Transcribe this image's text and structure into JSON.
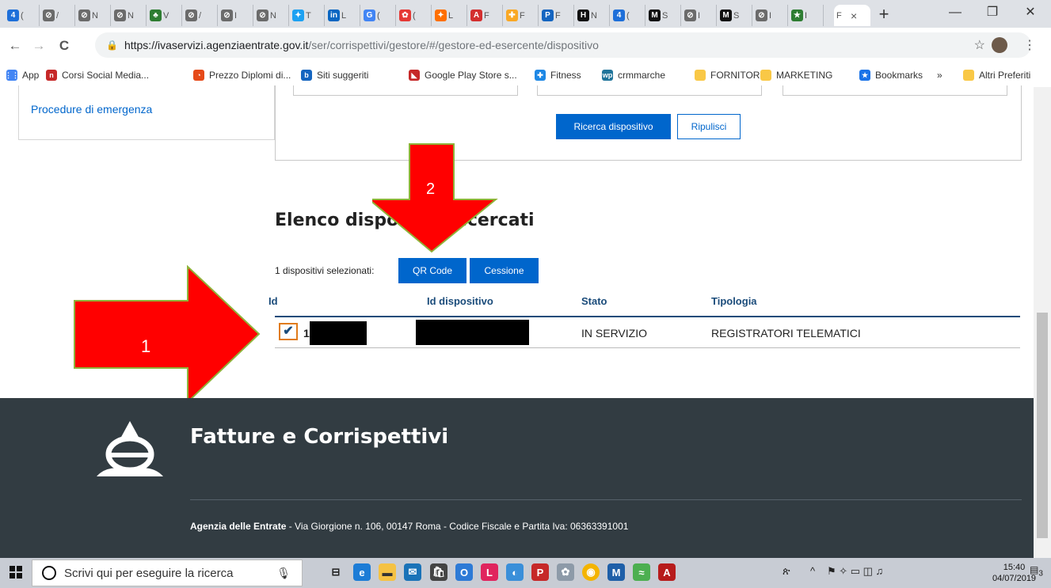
{
  "browser": {
    "tabs": [
      {
        "favicon_color": "#1e6fd9",
        "glyph": "4",
        "label": "("
      },
      {
        "favicon_color": "#6b6b6b",
        "glyph": "⊘",
        "label": "/"
      },
      {
        "favicon_color": "#6b6b6b",
        "glyph": "⊘",
        "label": "N"
      },
      {
        "favicon_color": "#6b6b6b",
        "glyph": "⊘",
        "label": "N"
      },
      {
        "favicon_color": "#2e7d32",
        "glyph": "♣",
        "label": "V"
      },
      {
        "favicon_color": "#6b6b6b",
        "glyph": "⊘",
        "label": "/"
      },
      {
        "favicon_color": "#6b6b6b",
        "glyph": "⊘",
        "label": "I"
      },
      {
        "favicon_color": "#6b6b6b",
        "glyph": "⊘",
        "label": "N"
      },
      {
        "favicon_color": "#1da1f2",
        "glyph": "✦",
        "label": "T"
      },
      {
        "favicon_color": "#0a66c2",
        "glyph": "in",
        "label": "L"
      },
      {
        "favicon_color": "#4285f4",
        "glyph": "G",
        "label": "("
      },
      {
        "favicon_color": "#e53935",
        "glyph": "✿",
        "label": "("
      },
      {
        "favicon_color": "#ff6f00",
        "glyph": "✦",
        "label": "L"
      },
      {
        "favicon_color": "#d32f2f",
        "glyph": "A",
        "label": "F"
      },
      {
        "favicon_color": "#f9a825",
        "glyph": "✚",
        "label": "F"
      },
      {
        "favicon_color": "#1565c0",
        "glyph": "P",
        "label": "F"
      },
      {
        "favicon_color": "#111111",
        "glyph": "H",
        "label": "N"
      },
      {
        "favicon_color": "#1e6fd9",
        "glyph": "4",
        "label": "("
      },
      {
        "favicon_color": "#111111",
        "glyph": "M",
        "label": "S"
      },
      {
        "favicon_color": "#6b6b6b",
        "glyph": "⊘",
        "label": "I"
      },
      {
        "favicon_color": "#111111",
        "glyph": "M",
        "label": "S"
      },
      {
        "favicon_color": "#6b6b6b",
        "glyph": "⊘",
        "label": "I"
      },
      {
        "favicon_color": "#2e7d32",
        "glyph": "★",
        "label": "I"
      }
    ],
    "active_tab": {
      "label": "F",
      "close": "×"
    },
    "new_tab": "+",
    "window": {
      "minimize": "—",
      "restore": "❐",
      "close": "✕"
    },
    "nav": {
      "back": "←",
      "forward": "→",
      "reload": "C"
    },
    "url_host": "https://ivaservizi.agenziaentrate.gov.it",
    "url_path": "/ser/corrispettivi/gestore/#/gestore-ed-esercente/dispositivo",
    "star": "☆",
    "menu": "⋮",
    "bookmarks": [
      {
        "label": "App",
        "color": "#4285f4",
        "glyph": "⋮⋮"
      },
      {
        "label": "Corsi Social Media...",
        "color": "#c62828",
        "glyph": "n"
      },
      {
        "label": "Prezzo Diplomi di...",
        "color": "#e64a19",
        "glyph": "◔"
      },
      {
        "label": "Siti suggeriti",
        "color": "#1565c0",
        "glyph": "b"
      },
      {
        "label": "Google Play Store s...",
        "color": "#c62828",
        "glyph": "◣"
      },
      {
        "label": "Fitness",
        "color": "#1e88e5",
        "glyph": "✚"
      },
      {
        "label": "crmmarche",
        "color": "#21759b",
        "glyph": "wp"
      },
      {
        "label": "FORNITORI",
        "color": "#f9c846",
        "glyph": ""
      },
      {
        "label": "MARKETING",
        "color": "#f9c846",
        "glyph": ""
      },
      {
        "label": "Bookmarks",
        "color": "#1a73e8",
        "glyph": "★"
      }
    ],
    "more_bookmarks": "»",
    "other_bookmarks": "Altri Preferiti"
  },
  "page": {
    "sidebar_link": "Procedure di emergenza",
    "search_button": "Ricerca dispositivo",
    "clear_button": "Ripulisci",
    "list_title": "Elenco dispositivi ricercati",
    "selected_info": "1 dispositivi selezionati:",
    "qr_button": "QR Code",
    "transfer_button": "Cessione",
    "table": {
      "headers": [
        "Id",
        "Id dispositivo",
        "Stato",
        "Tipologia"
      ],
      "rows": [
        {
          "id": "1",
          "device_id": "",
          "status": "IN SERVIZIO",
          "type": "REGISTRATORI TELEMATICI",
          "checked": true
        }
      ]
    },
    "footer": {
      "brand": "Fatture e Corrispettivi",
      "address_bold": "Agenzia delle Entrate",
      "address_rest": " - Via Giorgione n. 106, 00147 Roma - Codice Fiscale e Partita Iva: 06363391001"
    }
  },
  "annotations": {
    "arrow1_label": "1",
    "arrow2_label": "2",
    "arrow_color": "#ff0000",
    "arrow_outline": "#8fb339"
  },
  "taskbar": {
    "search_placeholder": "Scrivi qui per eseguire la ricerca",
    "time": "15:40",
    "date": "04/07/2019",
    "notifications": "3"
  }
}
